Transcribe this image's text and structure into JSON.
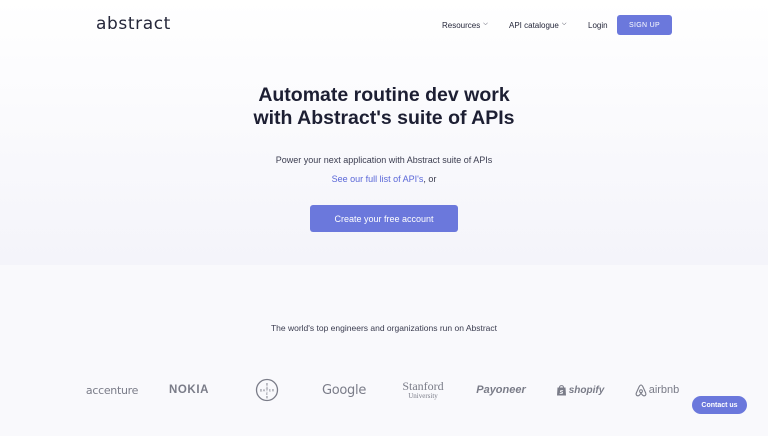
{
  "header": {
    "logo": "abstract",
    "nav": [
      {
        "label": "Resources"
      },
      {
        "label": "API catalogue"
      },
      {
        "label": "Login"
      }
    ],
    "signup_label": "SIGN UP"
  },
  "hero": {
    "title_line1": "Automate routine dev work",
    "title_line2": "with Abstract's suite of APIs",
    "subtitle": "Power your next application with Abstract suite of APIs",
    "link_text": "See our full list of API's",
    "link_suffix": ", or",
    "cta_label": "Create your free account"
  },
  "trusted": {
    "text": "The world's top engineers and organizations run on Abstract",
    "brands": {
      "accenture": "accenture",
      "nokia": "NOKIA",
      "bayer": "BAYER",
      "google": "Google",
      "stanford_1": "Stanford",
      "stanford_2": "University",
      "payoneer": "Payoneer",
      "shopify": "shopify",
      "airbnb": "airbnb"
    }
  },
  "contact_label": "Contact us",
  "colors": {
    "accent": "#6b78dc",
    "link": "#5a67d8",
    "text": "#1d1f33",
    "muted_logo": "#7a7c88"
  }
}
